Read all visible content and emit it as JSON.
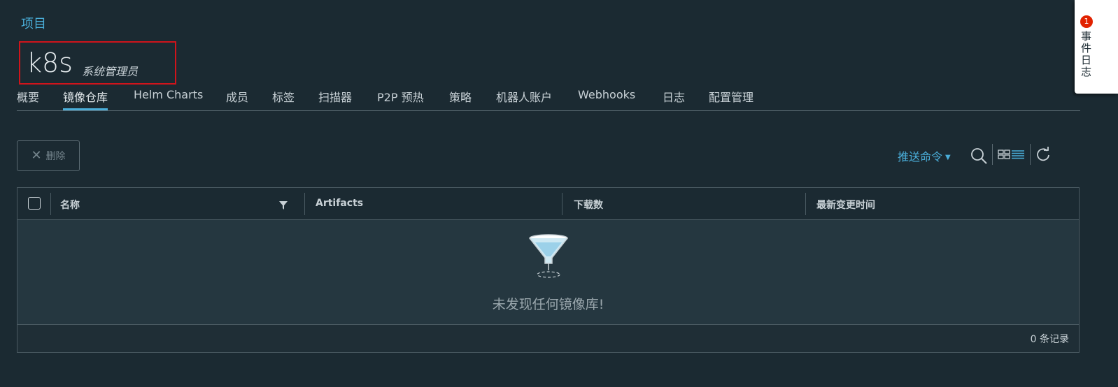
{
  "breadcrumb": "项目",
  "project": {
    "name": "k8s",
    "role": "系统管理员"
  },
  "tabs": [
    {
      "label": "概要"
    },
    {
      "label": "镜像仓库",
      "active": true
    },
    {
      "label": "Helm Charts"
    },
    {
      "label": "成员"
    },
    {
      "label": "标签"
    },
    {
      "label": "扫描器"
    },
    {
      "label": "P2P 预热"
    },
    {
      "label": "策略"
    },
    {
      "label": "机器人账户"
    },
    {
      "label": "Webhooks"
    },
    {
      "label": "日志"
    },
    {
      "label": "配置管理"
    }
  ],
  "toolbar": {
    "delete_label": "删除",
    "push_command_label": "推送命令"
  },
  "table": {
    "columns": [
      "名称",
      "Artifacts",
      "下载数",
      "最新变更时间"
    ],
    "empty_message": "未发现任何镜像库!",
    "footer": "0 条记录"
  },
  "event_panel": {
    "label": "事件日志",
    "badge": "1"
  },
  "colors": {
    "background": "#1b2a32",
    "accent": "#4aaed9",
    "highlight_border": "#d0141b",
    "badge": "#e12200"
  }
}
